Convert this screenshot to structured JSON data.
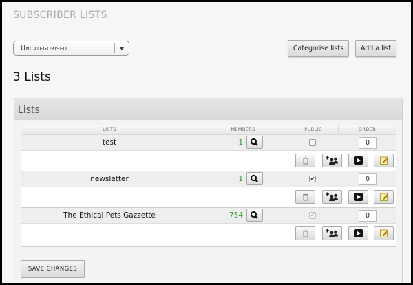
{
  "page": {
    "title": "SUBSCRIBER LISTS"
  },
  "category_select": {
    "value": "Uncategorised"
  },
  "toolbar": {
    "categorise_label": "Categorise lists",
    "add_label": "Add a list"
  },
  "summary": {
    "count_text": "3 Lists"
  },
  "panel": {
    "title": "Lists"
  },
  "table": {
    "headers": {
      "lists": "LISTS",
      "members": "MEMBERS",
      "public": "PUBLIC",
      "order": "ORDER"
    },
    "rows": [
      {
        "name": "test",
        "members": "1",
        "public": false,
        "public_enabled": true,
        "order": "0"
      },
      {
        "name": "newsletter",
        "members": "1",
        "public": true,
        "public_enabled": true,
        "order": "0"
      },
      {
        "name": "The Ethical Pets Gazzette",
        "members": "754",
        "public": true,
        "public_enabled": false,
        "order": "0"
      }
    ]
  },
  "footer": {
    "save_label": "SAVE CHANGES"
  },
  "colors": {
    "members_green": "#2c9a2c",
    "background": "#f6f6f6"
  },
  "icons": {
    "view": "magnifier-icon",
    "delete": "trash-icon",
    "add_subscribers": "add-users-icon",
    "send": "play-icon",
    "edit": "edit-pencil-icon"
  }
}
